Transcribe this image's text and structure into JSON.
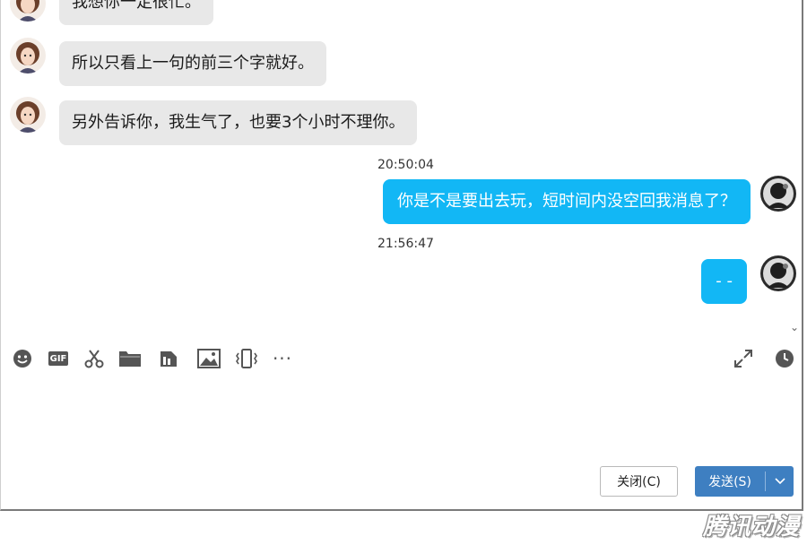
{
  "messages": {
    "m1": "我想你一定很忙。",
    "m2": "所以只看上一句的前三个字就好。",
    "m3": "另外告诉你，我生气了，也要3个小时不理你。",
    "ts1": "20:50:04",
    "m4": "你是不是要出去玩，短时间内没空回我消息了？",
    "ts2": "21:56:47",
    "m5": "- -"
  },
  "toolbar": {
    "icons": [
      "emoji-icon",
      "gif-icon",
      "scissors-icon",
      "folder-icon",
      "doc-icon",
      "image-icon",
      "shake-icon",
      "more-icon",
      "expand-icon",
      "history-icon"
    ],
    "gif_label": "GIF",
    "more_label": "···"
  },
  "buttons": {
    "close_label": "关闭(C)",
    "send_label": "发送(S)"
  },
  "watermark": "腾讯动漫",
  "colors": {
    "left_bubble": "#e8e8e8",
    "right_bubble": "#12b7f5",
    "send_button": "#3e7fc1"
  }
}
